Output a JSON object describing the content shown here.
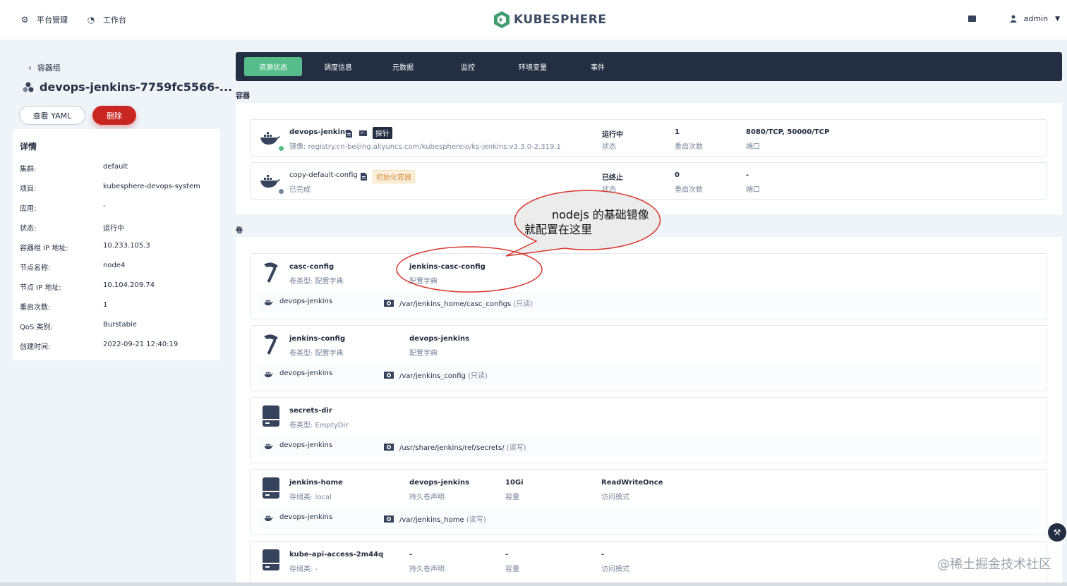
{
  "topbar": {
    "platform": "平台管理",
    "workbench": "工作台",
    "logo_text": "KUBESPHERE",
    "username": "admin"
  },
  "left": {
    "back_label": "容器组",
    "pod_name": "devops-jenkins-7759fc5566-...",
    "yaml_button": "查看 YAML",
    "delete_button": "删除",
    "details_title": "详情",
    "details": [
      {
        "k": "集群:",
        "v": "default"
      },
      {
        "k": "项目:",
        "v": "kubesphere-devops-system"
      },
      {
        "k": "应用:",
        "v": "-"
      },
      {
        "k": "状态:",
        "v": "运行中"
      },
      {
        "k": "容器组 IP 地址:",
        "v": "10.233.105.3"
      },
      {
        "k": "节点名称:",
        "v": "node4"
      },
      {
        "k": "节点 IP 地址:",
        "v": "10.104.209.74"
      },
      {
        "k": "重启次数:",
        "v": "1"
      },
      {
        "k": "QoS 类别:",
        "v": "Burstable"
      },
      {
        "k": "创建时间:",
        "v": "2022-09-21 12:40:19"
      }
    ]
  },
  "tabs": [
    "资源状态",
    "调度信息",
    "元数据",
    "监控",
    "环境变量",
    "事件"
  ],
  "containers_title": "容器",
  "containers": [
    {
      "name": "devops-jenkins",
      "tag": "探针",
      "image": "镜像:  registry.cn-beijing.aliyuncs.com/kubesphereio/ks-jenkins:v3.3.0-2.319.1",
      "status": "运行中",
      "status_label": "状态",
      "restarts": "1",
      "restarts_label": "重启次数",
      "ports": "8080/TCP, 50000/TCP",
      "ports_label": "端口"
    },
    {
      "name": "copy-default-config",
      "tag": "初始化容器",
      "image": "已完成",
      "status": "已终止",
      "status_label": "状态",
      "restarts": "0",
      "restarts_label": "重启次数",
      "ports": "-",
      "ports_label": "端口"
    }
  ],
  "volumes_title": "卷",
  "volumes": [
    {
      "name": "casc-config",
      "type": "卷类型:  配置字典",
      "ref": "jenkins-casc-config",
      "ref_label": "配置字典",
      "mount_container": "devops-jenkins",
      "mount_path": "/var/jenkins_home/casc_configs",
      "mount_mode": "(只读)"
    },
    {
      "name": "jenkins-config",
      "type": "卷类型:  配置字典",
      "ref": "devops-jenkins",
      "ref_label": "配置字典",
      "mount_container": "devops-jenkins",
      "mount_path": "/var/jenkins_config",
      "mount_mode": "(只读)"
    },
    {
      "name": "secrets-dir",
      "type": "卷类型:  EmptyDir",
      "mount_container": "devops-jenkins",
      "mount_path": "/usr/share/jenkins/ref/secrets/",
      "mount_mode": "(读写)"
    },
    {
      "name": "jenkins-home",
      "type": "存储类:  local",
      "ref": "devops-jenkins",
      "ref_label": "持久卷声明",
      "capacity": "10Gi",
      "capacity_label": "容量",
      "access": "ReadWriteOnce",
      "access_label": "访问模式",
      "mount_container": "devops-jenkins",
      "mount_path": "/var/jenkins_home",
      "mount_mode": "(读写)"
    },
    {
      "name": "kube-api-access-2m44q",
      "type": "存储类:  -",
      "ref": "-",
      "ref_label": "持久卷声明",
      "capacity": "-",
      "capacity_label": "容量",
      "access": "-",
      "access_label": "访问模式"
    }
  ],
  "callout": {
    "line1": "nodejs 的基础镜像",
    "line2": "就配置在这里"
  },
  "watermark": "@稀土掘金技术社区",
  "colors": {
    "accent": "#55bc8a",
    "danger": "#ca2621",
    "dark": "#242e42",
    "callout_stroke": "#d9382f"
  }
}
